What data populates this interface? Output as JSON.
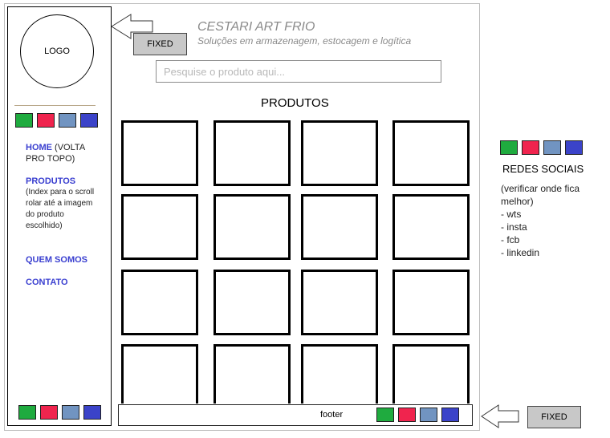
{
  "site": {
    "title": "CESTARI ART FRIO",
    "tagline": "Soluções em armazenagem, estocagem e logítica"
  },
  "sidebar": {
    "logo_text": "LOGO",
    "nav": [
      {
        "link": "HOME",
        "note": " (VOLTA PRO TOPO)"
      },
      {
        "link": "PRODUTOS",
        "note": "(Index para o scroll rolar até a imagem do produto escolhido)"
      },
      {
        "link": "QUEM SOMOS",
        "note": ""
      },
      {
        "link": "CONTATO",
        "note": ""
      }
    ]
  },
  "fixed_labels": {
    "header": "FIXED",
    "footer": "FIXED"
  },
  "search": {
    "placeholder": "Pesquise o produto aqui..."
  },
  "products": {
    "title": "PRODUTOS"
  },
  "footer": {
    "label": "footer"
  },
  "social": {
    "title": "REDES SOCIAIS",
    "note": "(verificar onde fica melhor)",
    "items": [
      "- wts",
      "- insta",
      "- fcb",
      "- linkedin"
    ]
  },
  "colors": {
    "green": "#1fab3f",
    "red": "#f0244e",
    "steel": "#7194c1",
    "blue": "#3b43c9",
    "link": "#3a3fd0",
    "muted_text": "#8a8a8a"
  },
  "icons": [
    "arrow-left-icon"
  ]
}
